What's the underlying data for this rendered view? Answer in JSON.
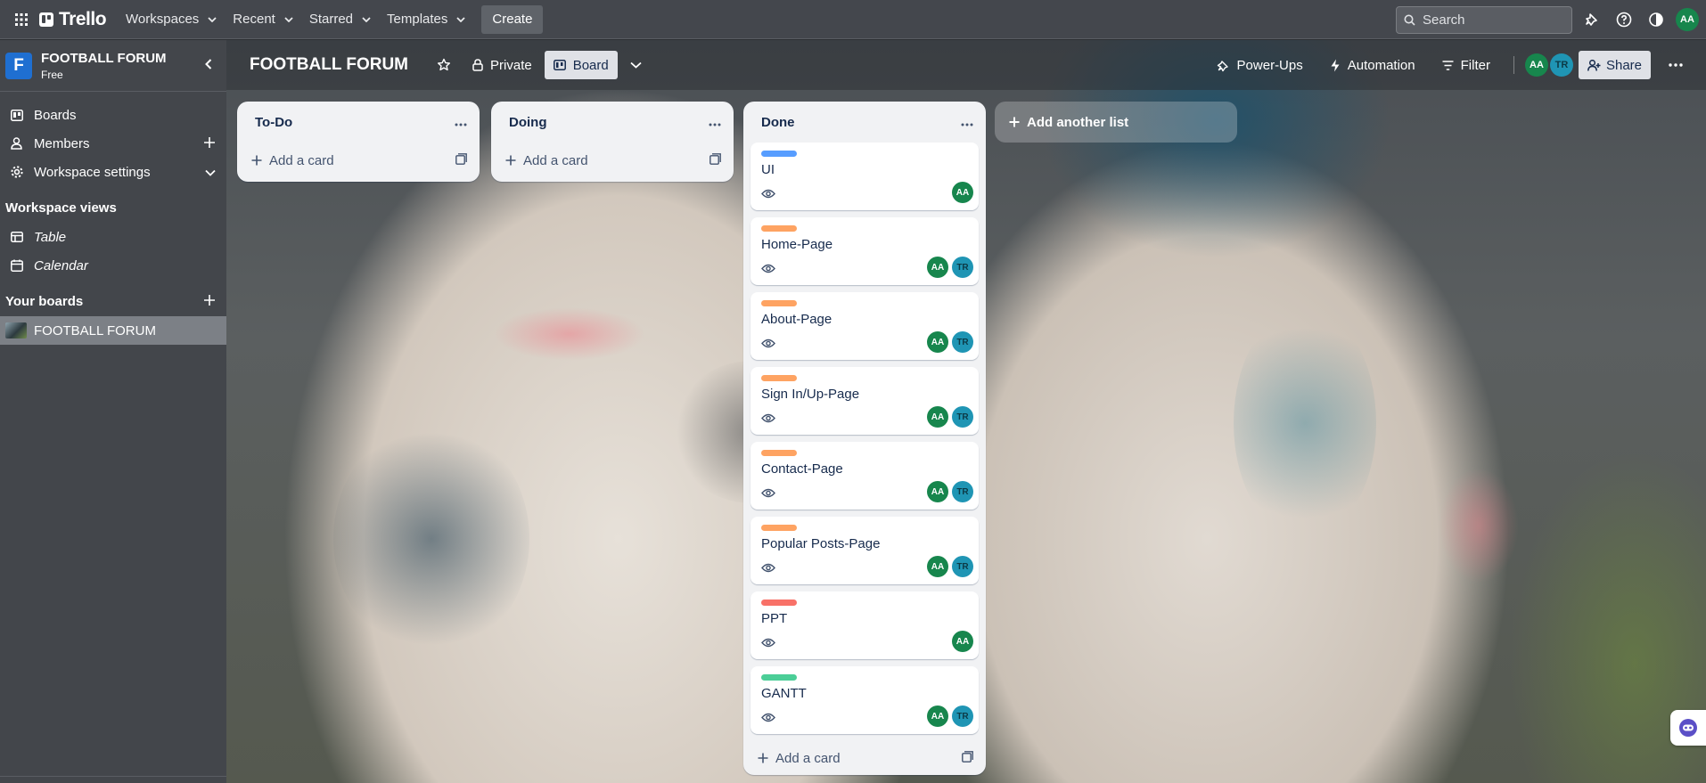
{
  "header": {
    "app_name": "Trello",
    "menus": [
      "Workspaces",
      "Recent",
      "Starred",
      "Templates"
    ],
    "create_label": "Create",
    "search_placeholder": "Search",
    "user_avatar": "AA"
  },
  "sidebar": {
    "workspace_initial": "F",
    "workspace_name": "FOOTBALL FORUM",
    "workspace_plan": "Free",
    "items": [
      {
        "label": "Boards",
        "icon": "trello-board-icon"
      },
      {
        "label": "Members",
        "icon": "person-icon"
      },
      {
        "label": "Workspace settings",
        "icon": "gear-icon"
      }
    ],
    "views_heading": "Workspace views",
    "views": [
      {
        "label": "Table",
        "icon": "table-icon"
      },
      {
        "label": "Calendar",
        "icon": "calendar-icon"
      }
    ],
    "boards_heading": "Your boards",
    "boards": [
      {
        "label": "FOOTBALL FORUM"
      }
    ]
  },
  "board": {
    "title": "FOOTBALL FORUM",
    "visibility": "Private",
    "view": "Board",
    "power_ups": "Power-Ups",
    "automation": "Automation",
    "filter": "Filter",
    "members": [
      "AA",
      "TR"
    ],
    "share": "Share",
    "add_list": "Add another list"
  },
  "lists": [
    {
      "title": "To-Do",
      "add_card": "Add a card",
      "cards": []
    },
    {
      "title": "Doing",
      "add_card": "Add a card",
      "cards": []
    },
    {
      "title": "Done",
      "add_card": "Add a card",
      "cards": [
        {
          "title": "UI",
          "label_color": "#579dff",
          "members": [
            "AA"
          ]
        },
        {
          "title": "Home-Page",
          "label_color": "#fea362",
          "members": [
            "AA",
            "TR"
          ]
        },
        {
          "title": "About-Page",
          "label_color": "#fea362",
          "members": [
            "AA",
            "TR"
          ]
        },
        {
          "title": "Sign In/Up-Page",
          "label_color": "#fea362",
          "members": [
            "AA",
            "TR"
          ]
        },
        {
          "title": "Contact-Page",
          "label_color": "#fea362",
          "members": [
            "AA",
            "TR"
          ]
        },
        {
          "title": "Popular Posts-Page",
          "label_color": "#fea362",
          "members": [
            "AA",
            "TR"
          ]
        },
        {
          "title": "PPT",
          "label_color": "#f87168",
          "members": [
            "AA"
          ]
        },
        {
          "title": "GANTT",
          "label_color": "#4bce97",
          "members": [
            "AA",
            "TR"
          ]
        }
      ]
    }
  ],
  "colors": {
    "header_bg": "#44474d",
    "sidebar_bg": "#43464b",
    "avatar_aa": "#17864d",
    "avatar_tr": "#1f95b4",
    "workspace_logo": "#1f6fd1"
  }
}
